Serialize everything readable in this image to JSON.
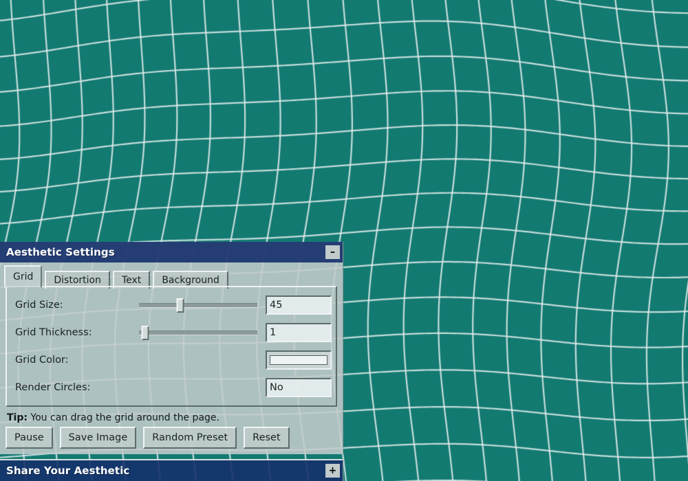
{
  "background": {
    "name": "warped-grid-canvas",
    "bg_color": "#137a72",
    "line_color": "#dfeceb",
    "grid_size": 45,
    "line_thickness": 1
  },
  "panel": {
    "title": "Aesthetic Settings",
    "minimize_label": "–",
    "tabs": [
      {
        "label": "Grid",
        "active": true
      },
      {
        "label": "Distortion",
        "active": false
      },
      {
        "label": "Text",
        "active": false
      },
      {
        "label": "Background",
        "active": false
      }
    ],
    "settings": [
      {
        "label": "Grid Size:",
        "control": "slider",
        "value": "45",
        "slider_percent": 35
      },
      {
        "label": "Grid Thickness:",
        "control": "slider",
        "value": "1",
        "slider_percent": 5
      },
      {
        "label": "Grid Color:",
        "control": "color",
        "value": "#eef3f3"
      },
      {
        "label": "Render Circles:",
        "control": "text",
        "value": "No"
      }
    ],
    "tip_prefix": "Tip:",
    "tip_text": " You can drag the grid around the page.",
    "buttons": [
      {
        "label": "Pause"
      },
      {
        "label": "Save Image"
      },
      {
        "label": "Random Preset"
      },
      {
        "label": "Reset"
      }
    ]
  },
  "share": {
    "title": "Share Your Aesthetic",
    "expand_label": "+"
  }
}
